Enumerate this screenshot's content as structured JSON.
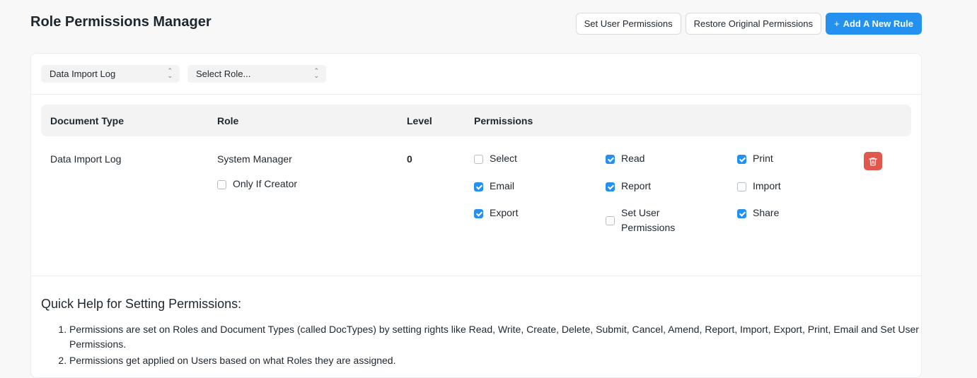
{
  "header": {
    "title": "Role Permissions Manager",
    "set_user_permissions": "Set User Permissions",
    "restore_original": "Restore Original Permissions",
    "add_rule_plus": "+",
    "add_rule": "Add A New Rule"
  },
  "filters": {
    "doctype_value": "Data Import Log",
    "role_placeholder": "Select Role..."
  },
  "table": {
    "columns": [
      "Document Type",
      "Role",
      "Level",
      "Permissions"
    ],
    "rows": [
      {
        "document_type": "Data Import Log",
        "role": "System Manager",
        "only_if_creator": {
          "label": "Only If Creator",
          "checked": false
        },
        "level": "0",
        "permissions": [
          {
            "label": "Select",
            "checked": false
          },
          {
            "label": "Read",
            "checked": true
          },
          {
            "label": "Print",
            "checked": true
          },
          {
            "label": "Email",
            "checked": true
          },
          {
            "label": "Report",
            "checked": true
          },
          {
            "label": "Import",
            "checked": false
          },
          {
            "label": "Export",
            "checked": true
          },
          {
            "label": "Set User Permissions",
            "checked": false
          },
          {
            "label": "Share",
            "checked": true
          }
        ]
      }
    ]
  },
  "help": {
    "title": "Quick Help for Setting Permissions:",
    "items": [
      "Permissions are set on Roles and Document Types (called DocTypes) by setting rights like Read, Write, Create, Delete, Submit, Cancel, Amend, Report, Import, Export, Print, Email and Set User Permissions.",
      "Permissions get applied on Users based on what Roles they are assigned."
    ]
  },
  "colors": {
    "primary": "#2490ef",
    "danger": "#e2574c"
  },
  "icons": {
    "delete": "trash-icon",
    "select_arrows": "chevron-up-down-icon"
  }
}
